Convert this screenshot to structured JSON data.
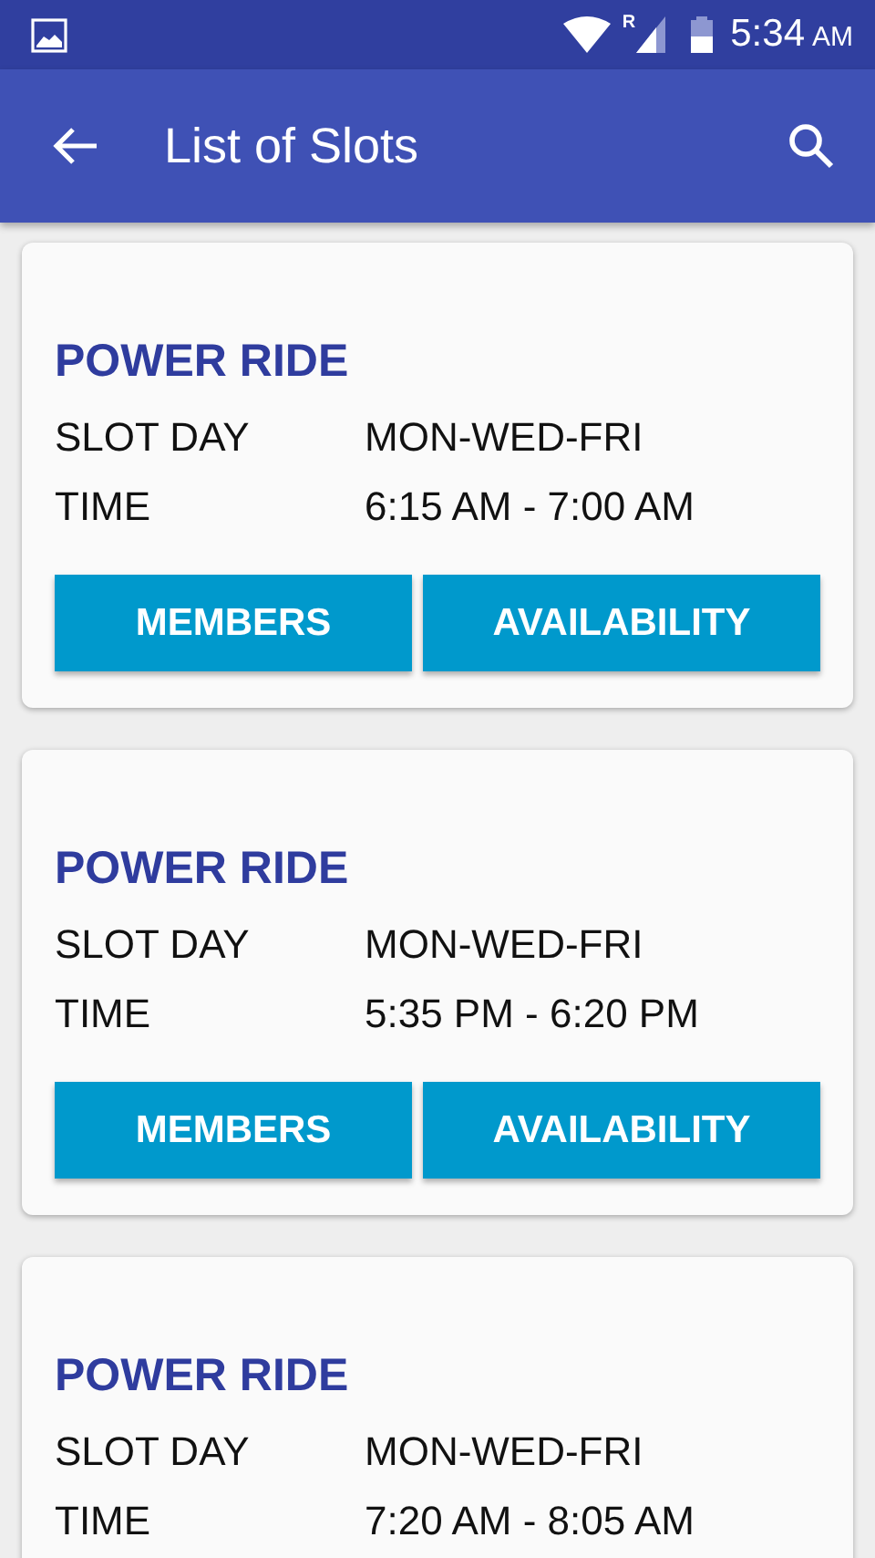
{
  "status_bar": {
    "network_label": "R",
    "time": "5:34",
    "period": "AM"
  },
  "app_bar": {
    "title": "List of Slots"
  },
  "slots": [
    {
      "title": "POWER RIDE",
      "rows": [
        {
          "label": "SLOT DAY",
          "value": "MON-WED-FRI"
        },
        {
          "label": "TIME",
          "value": "6:15 AM - 7:00 AM"
        }
      ],
      "buttons": [
        "MEMBERS",
        "AVAILABILITY"
      ]
    },
    {
      "title": "POWER RIDE",
      "rows": [
        {
          "label": "SLOT DAY",
          "value": "MON-WED-FRI"
        },
        {
          "label": "TIME",
          "value": "5:35 PM - 6:20 PM"
        }
      ],
      "buttons": [
        "MEMBERS",
        "AVAILABILITY"
      ]
    },
    {
      "title": "POWER RIDE",
      "rows": [
        {
          "label": "SLOT DAY",
          "value": "MON-WED-FRI"
        },
        {
          "label": "TIME",
          "value": "7:20 AM - 8:05 AM"
        }
      ]
    }
  ]
}
